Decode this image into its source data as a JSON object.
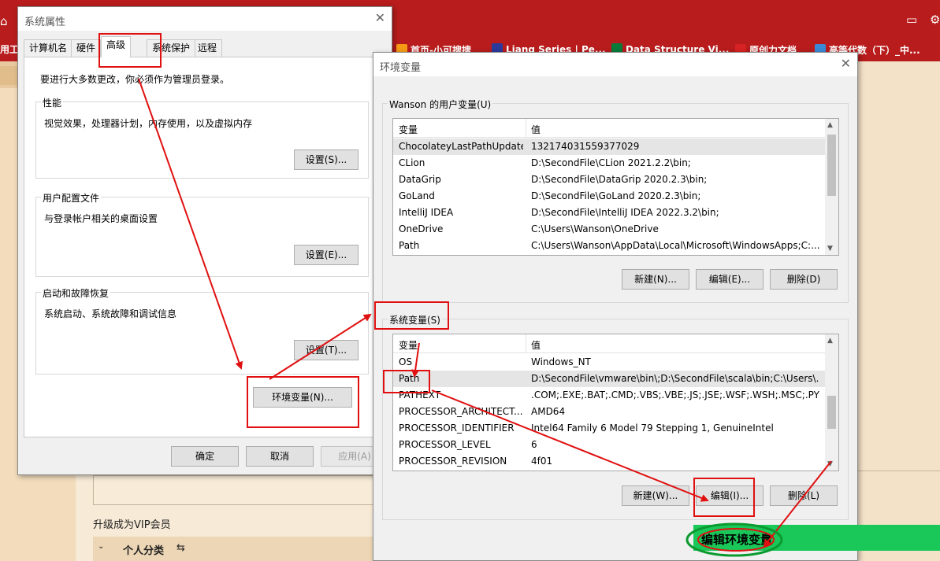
{
  "browser": {
    "left_cut_label": "用工",
    "bookmarks": [
      {
        "label": "首页-小可搜搜",
        "icon": "flame-icon",
        "color": "#f59b16"
      },
      {
        "label": "Liang Series | Pe...",
        "icon": "p-logo-icon",
        "color": "#2b3a9a"
      },
      {
        "label": "Data Structure Vi...",
        "icon": "usf-logo-icon",
        "color": "#0a7a3a"
      },
      {
        "label": "原创力文档",
        "icon": "doc-logo-icon",
        "color": "#d62222"
      },
      {
        "label": "高等代数（下）_中...",
        "icon": "book-logo-icon",
        "color": "#3a8ad6"
      }
    ]
  },
  "page": {
    "vip_text": "升级成为VIP会员",
    "category_label": "个人分类",
    "category_sort_icon": "⇆"
  },
  "sys_props": {
    "title": "系统属性",
    "tabs": [
      "计算机名",
      "硬件",
      "高级",
      "系统保护",
      "远程"
    ],
    "notice": "要进行大多数更改，你必须作为管理员登录。",
    "perf": {
      "label": "性能",
      "desc": "视觉效果，处理器计划，内存使用，以及虚拟内存",
      "button": "设置(S)..."
    },
    "profile": {
      "label": "用户配置文件",
      "desc": "与登录帐户相关的桌面设置",
      "button": "设置(E)..."
    },
    "startup": {
      "label": "启动和故障恢复",
      "desc": "系统启动、系统故障和调试信息",
      "button": "设置(T)..."
    },
    "env_button": "环境变量(N)...",
    "ok": "确定",
    "cancel": "取消",
    "apply": "应用(A)"
  },
  "env_vars": {
    "title": "环境变量",
    "user_group_label": "Wanson 的用户变量(U)",
    "system_group_label": "系统变量(S)",
    "col_var": "变量",
    "col_val": "值",
    "user_rows": [
      {
        "name": "ChocolateyLastPathUpdate",
        "value": "132174031559377029"
      },
      {
        "name": "CLion",
        "value": "D:\\SecondFile\\CLion 2021.2.2\\bin;"
      },
      {
        "name": "DataGrip",
        "value": "D:\\SecondFile\\DataGrip 2020.2.3\\bin;"
      },
      {
        "name": "GoLand",
        "value": "D:\\SecondFile\\GoLand 2020.2.3\\bin;"
      },
      {
        "name": "IntelliJ IDEA",
        "value": "D:\\SecondFile\\IntelliJ IDEA 2022.3.2\\bin;"
      },
      {
        "name": "OneDrive",
        "value": "C:\\Users\\Wanson\\OneDrive"
      },
      {
        "name": "Path",
        "value": "C:\\Users\\Wanson\\AppData\\Local\\Microsoft\\WindowsApps;C:..."
      }
    ],
    "system_rows": [
      {
        "name": "OS",
        "value": "Windows_NT"
      },
      {
        "name": "Path",
        "value": "D:\\SecondFile\\vmware\\bin\\;D:\\SecondFile\\scala\\bin;C:\\Users\\..."
      },
      {
        "name": "PATHEXT",
        "value": ".COM;.EXE;.BAT;.CMD;.VBS;.VBE;.JS;.JSE;.WSF;.WSH;.MSC;.PY;.P..."
      },
      {
        "name": "PROCESSOR_ARCHITECT...",
        "value": "AMD64"
      },
      {
        "name": "PROCESSOR_IDENTIFIER",
        "value": "Intel64 Family 6 Model 79 Stepping 1, GenuineIntel"
      },
      {
        "name": "PROCESSOR_LEVEL",
        "value": "6"
      },
      {
        "name": "PROCESSOR_REVISION",
        "value": "4f01"
      }
    ],
    "user_buttons": {
      "new": "新建(N)...",
      "edit": "编辑(E)...",
      "delete": "删除(D)"
    },
    "system_buttons": {
      "new": "新建(W)...",
      "edit": "编辑(I)...",
      "delete": "删除(L)"
    }
  },
  "edit_window": {
    "title": "编辑环境变量"
  },
  "colors": {
    "annotation": "#e01010",
    "green_bar": "#1ac85a",
    "green_circle": "#0b9a30",
    "browser_bar": "#b81c1c"
  }
}
